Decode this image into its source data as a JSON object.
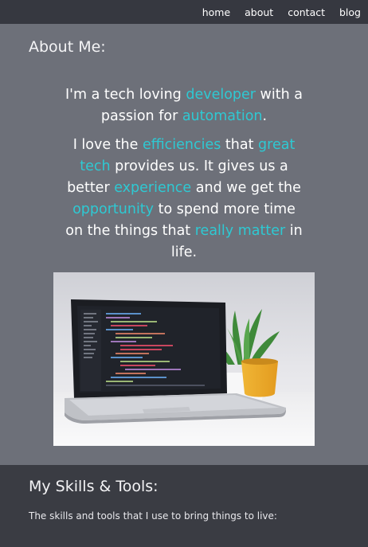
{
  "nav": {
    "links": [
      "home",
      "about",
      "contact",
      "blog"
    ]
  },
  "about": {
    "heading": "About Me:",
    "para1": [
      {
        "t": "I'm a tech loving ",
        "hl": false
      },
      {
        "t": "developer",
        "hl": true
      },
      {
        "t": " with a passion for ",
        "hl": false
      },
      {
        "t": "automation",
        "hl": true
      },
      {
        "t": ".",
        "hl": false
      }
    ],
    "para2": [
      {
        "t": "I love the ",
        "hl": false
      },
      {
        "t": "efficiencies",
        "hl": true
      },
      {
        "t": " that ",
        "hl": false
      },
      {
        "t": "great tech",
        "hl": true
      },
      {
        "t": " provides us. It gives us a better ",
        "hl": false
      },
      {
        "t": "experience",
        "hl": true
      },
      {
        "t": " and we get the ",
        "hl": false
      },
      {
        "t": "opportunity",
        "hl": true
      },
      {
        "t": " to spend more time on the things that ",
        "hl": false
      },
      {
        "t": "really matter",
        "hl": true
      },
      {
        "t": " in life.",
        "hl": false
      }
    ],
    "image": {
      "subject": "laptop-with-code-and-plant"
    }
  },
  "skills": {
    "heading": "My Skills & Tools:",
    "intro": "The skills and tools that I use to bring things to live:"
  },
  "colors": {
    "accent": "#2ec9d3",
    "nav_bg": "#363840",
    "about_bg": "#6d7079",
    "skills_bg": "#3a3c43"
  }
}
